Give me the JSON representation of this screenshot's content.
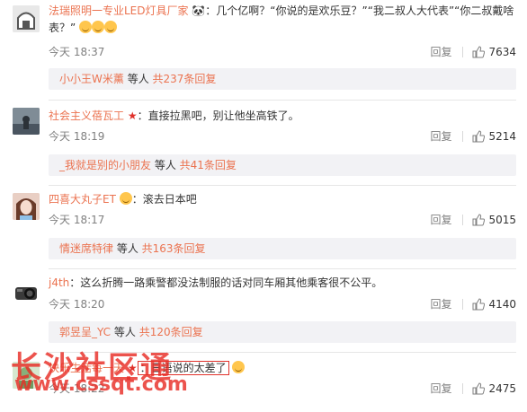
{
  "comments": [
    {
      "username": "法瑞照明一专业LED灯具厂家",
      "text": "：几个亿啊？“你说的是欢乐豆？”“我二叔人大代表”“你二叔戴啥表？”",
      "time": "今天 18:37",
      "reply_label": "回复",
      "likes": "7634",
      "sub_user": "小小王W米薰",
      "sub_text": " 等人 ",
      "sub_count": "共237条回复"
    },
    {
      "username": "社会主义蓓瓦工",
      "text": "：直接拉黑吧，别让他坐高铁了。",
      "time": "今天 18:19",
      "reply_label": "回复",
      "likes": "5214",
      "sub_user": "_我就是别的小朋友",
      "sub_text": " 等人 ",
      "sub_count": "共41条回复"
    },
    {
      "username": "四喜大丸子ET",
      "text": "：滚去日本吧",
      "time": "今天 18:17",
      "reply_label": "回复",
      "likes": "5015",
      "sub_user": "情迷席特律",
      "sub_text": " 等人 ",
      "sub_count": "共163条回复"
    },
    {
      "username": "j4th",
      "text": "：这么折腾一路乘警都没法制服的话对同车厢其他乘客很不公平。",
      "time": "今天 18:20",
      "reply_label": "回复",
      "likes": "4140",
      "sub_user": "郭昱呈_YC",
      "sub_text": " 等人 ",
      "sub_count": "共120条回复"
    },
    {
      "username": "快乐生活每一天",
      "text": "：日语说的太差了",
      "time": "今天 18:22",
      "reply_label": "回复",
      "likes": "2475"
    }
  ],
  "watermark": {
    "title": "长沙社区通",
    "url": "www.cssqt.com"
  },
  "colors": {
    "username": "#eb7350",
    "meta": "#808080",
    "sub_bg": "#f2f2f5",
    "watermark": "#e82d26"
  }
}
